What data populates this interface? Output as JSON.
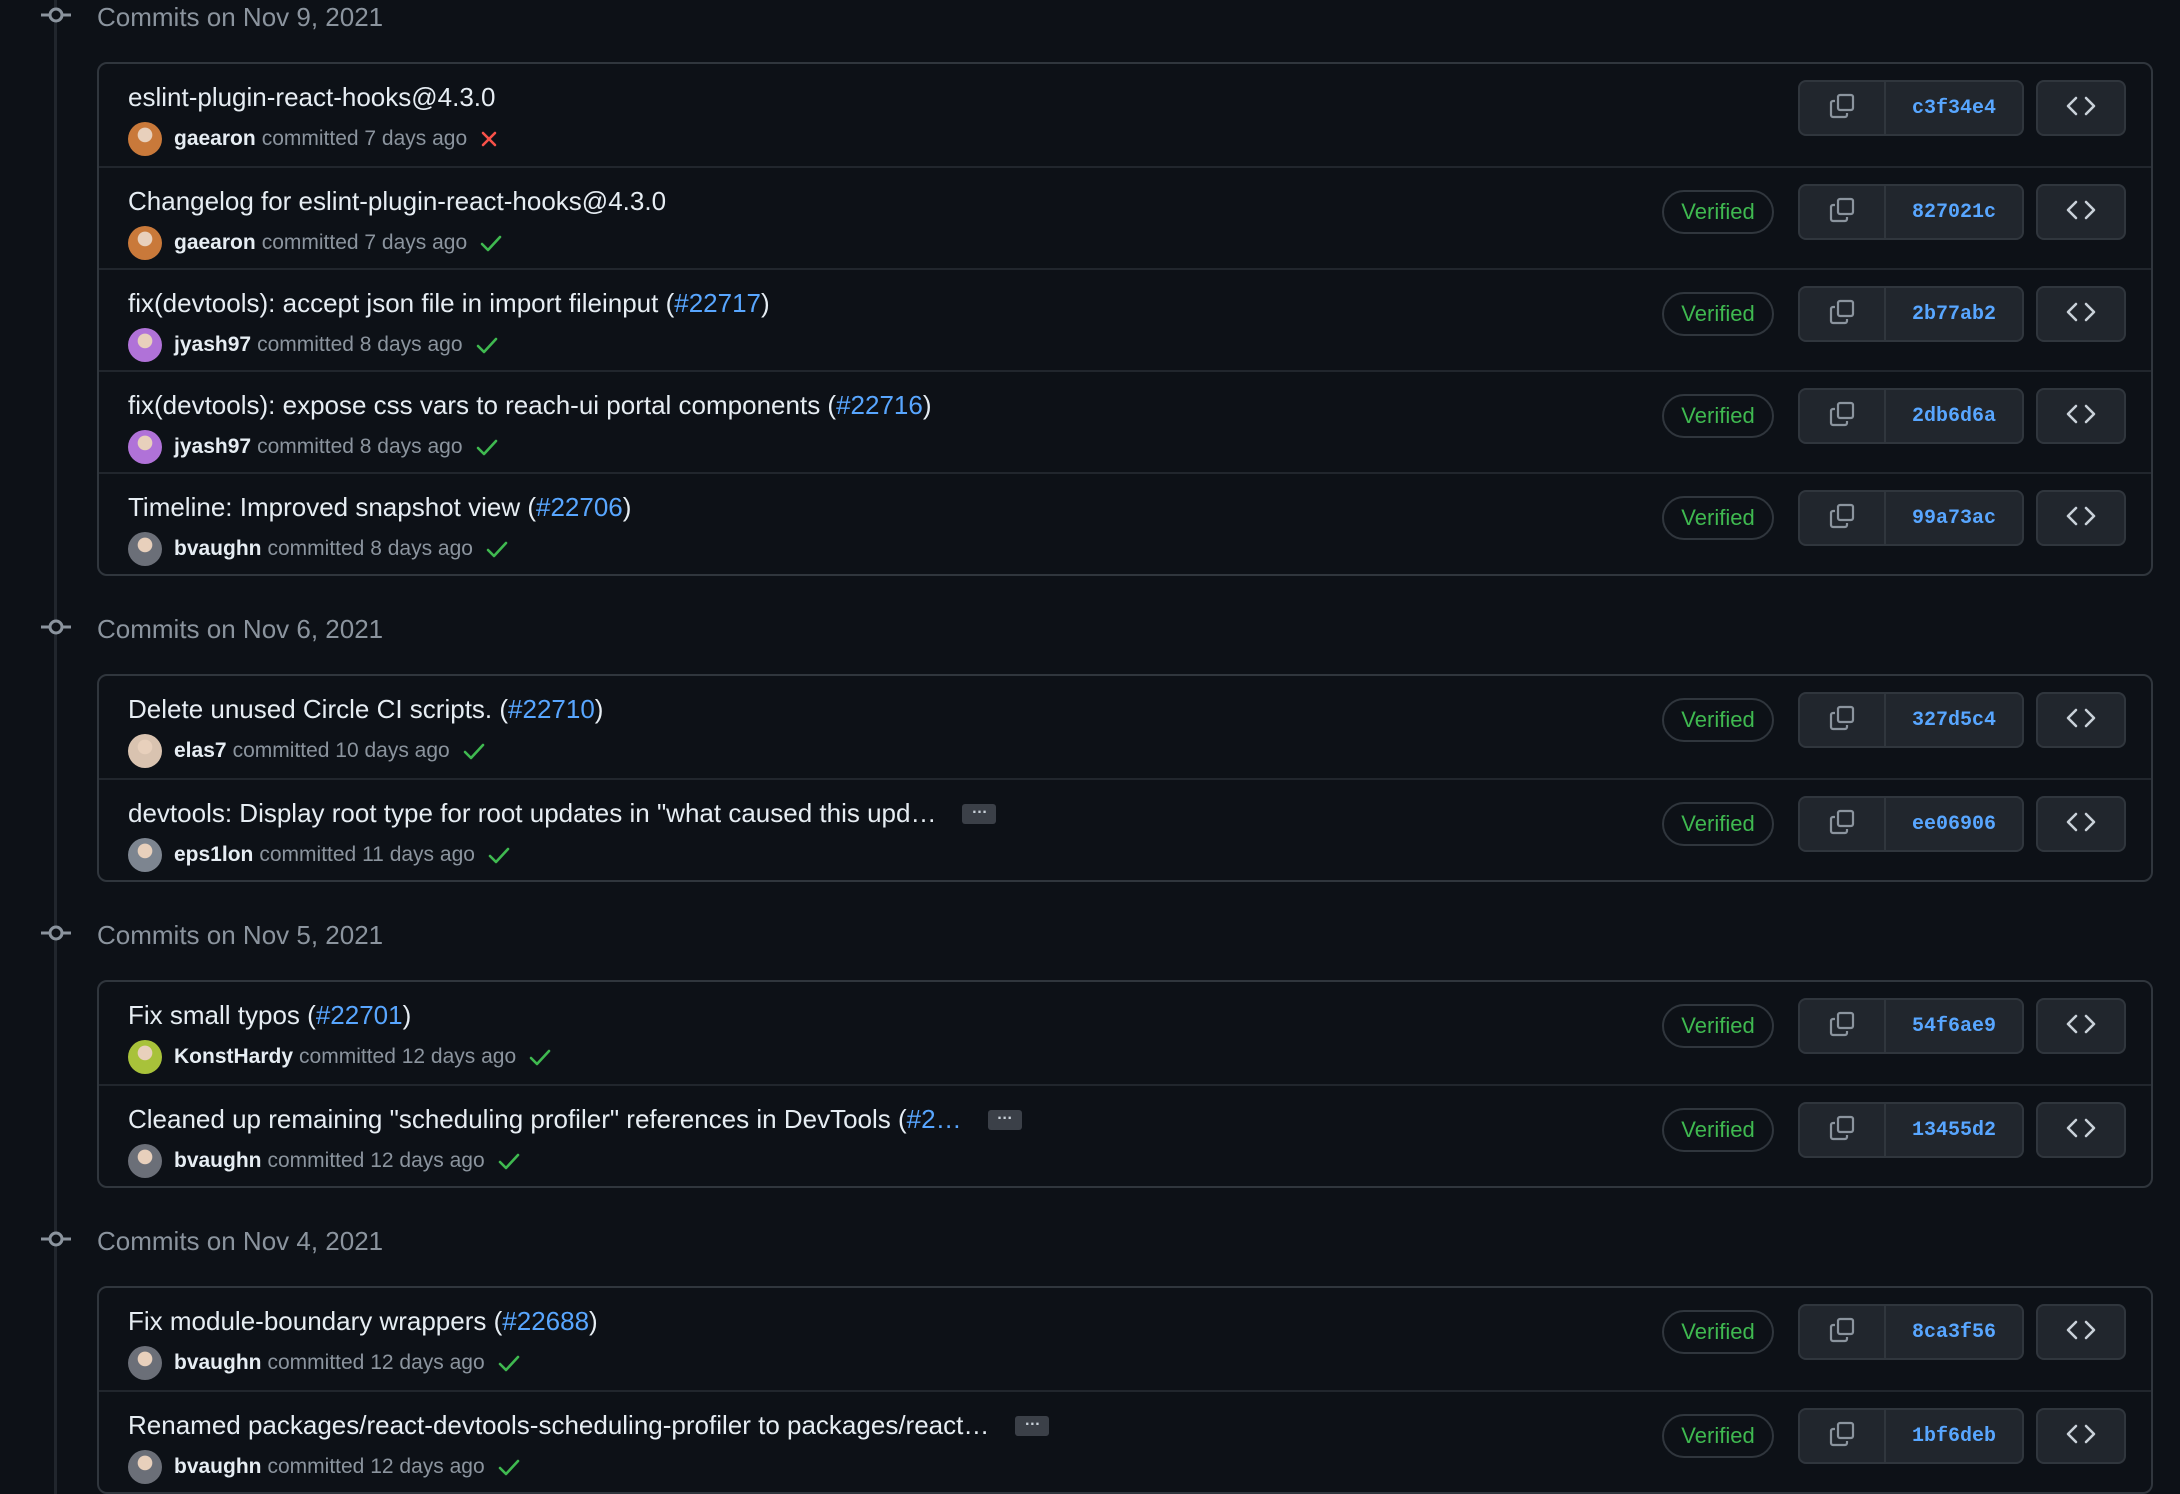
{
  "colors": {
    "background": "#0d1117",
    "border": "#30363d",
    "link": "#58a6ff",
    "verified": "#3fb950",
    "fail": "#f85149"
  },
  "labels": {
    "committed": "committed",
    "verified": "Verified"
  },
  "icons": {
    "commit": "git-commit-icon",
    "copy": "copy-icon",
    "browse": "code-icon",
    "success": "check-icon",
    "failure": "x-icon"
  },
  "groups": [
    {
      "date": "Commits on Nov 9, 2021",
      "commits": [
        {
          "message": "eslint-plugin-react-hooks@4.3.0",
          "pr": "",
          "suffix": "",
          "truncated": false,
          "author": "gaearon",
          "time": "7 days ago",
          "status": "failure",
          "verified": false,
          "sha": "c3f34e4",
          "avatar": "#c9793a"
        },
        {
          "message": "Changelog for eslint-plugin-react-hooks@4.3.0",
          "pr": "",
          "suffix": "",
          "truncated": false,
          "author": "gaearon",
          "time": "7 days ago",
          "status": "success",
          "verified": true,
          "sha": "827021c",
          "avatar": "#c9793a"
        },
        {
          "message": "fix(devtools): accept json file in import fileinput (",
          "pr": "#22717",
          "suffix": ")",
          "truncated": false,
          "author": "jyash97",
          "time": "8 days ago",
          "status": "success",
          "verified": true,
          "sha": "2b77ab2",
          "avatar": "#b072d8"
        },
        {
          "message": "fix(devtools): expose css vars to reach-ui portal components (",
          "pr": "#22716",
          "suffix": ")",
          "truncated": false,
          "author": "jyash97",
          "time": "8 days ago",
          "status": "success",
          "verified": true,
          "sha": "2db6d6a",
          "avatar": "#b072d8"
        },
        {
          "message": "Timeline: Improved snapshot view (",
          "pr": "#22706",
          "suffix": ")",
          "truncated": false,
          "author": "bvaughn",
          "time": "8 days ago",
          "status": "success",
          "verified": true,
          "sha": "99a73ac",
          "avatar": "#6b6f78"
        }
      ]
    },
    {
      "date": "Commits on Nov 6, 2021",
      "commits": [
        {
          "message": "Delete unused Circle CI scripts. (",
          "pr": "#22710",
          "suffix": ")",
          "truncated": false,
          "author": "elas7",
          "time": "10 days ago",
          "status": "success",
          "verified": true,
          "sha": "327d5c4",
          "avatar": "#d9c3b0"
        },
        {
          "message": "devtools: Display root type for root updates in \"what caused this upd…",
          "pr": "",
          "suffix": "",
          "truncated": true,
          "author": "eps1lon",
          "time": "11 days ago",
          "status": "success",
          "verified": true,
          "sha": "ee06906",
          "avatar": "#7d8590"
        }
      ]
    },
    {
      "date": "Commits on Nov 5, 2021",
      "commits": [
        {
          "message": "Fix small typos (",
          "pr": "#22701",
          "suffix": ")",
          "truncated": false,
          "author": "KonstHardy",
          "time": "12 days ago",
          "status": "success",
          "verified": true,
          "sha": "54f6ae9",
          "avatar": "#a8c23a"
        },
        {
          "message": "Cleaned up remaining \"scheduling profiler\" references in DevTools (",
          "pr": "#2…",
          "suffix": "",
          "truncated": true,
          "author": "bvaughn",
          "time": "12 days ago",
          "status": "success",
          "verified": true,
          "sha": "13455d2",
          "avatar": "#6b6f78"
        }
      ]
    },
    {
      "date": "Commits on Nov 4, 2021",
      "commits": [
        {
          "message": "Fix module-boundary wrappers (",
          "pr": "#22688",
          "suffix": ")",
          "truncated": false,
          "author": "bvaughn",
          "time": "12 days ago",
          "status": "success",
          "verified": true,
          "sha": "8ca3f56",
          "avatar": "#6b6f78"
        },
        {
          "message": "Renamed packages/react-devtools-scheduling-profiler to packages/react…",
          "pr": "",
          "suffix": "",
          "truncated": true,
          "author": "bvaughn",
          "time": "12 days ago",
          "status": "success",
          "verified": true,
          "sha": "1bf6deb",
          "avatar": "#6b6f78"
        }
      ]
    }
  ]
}
